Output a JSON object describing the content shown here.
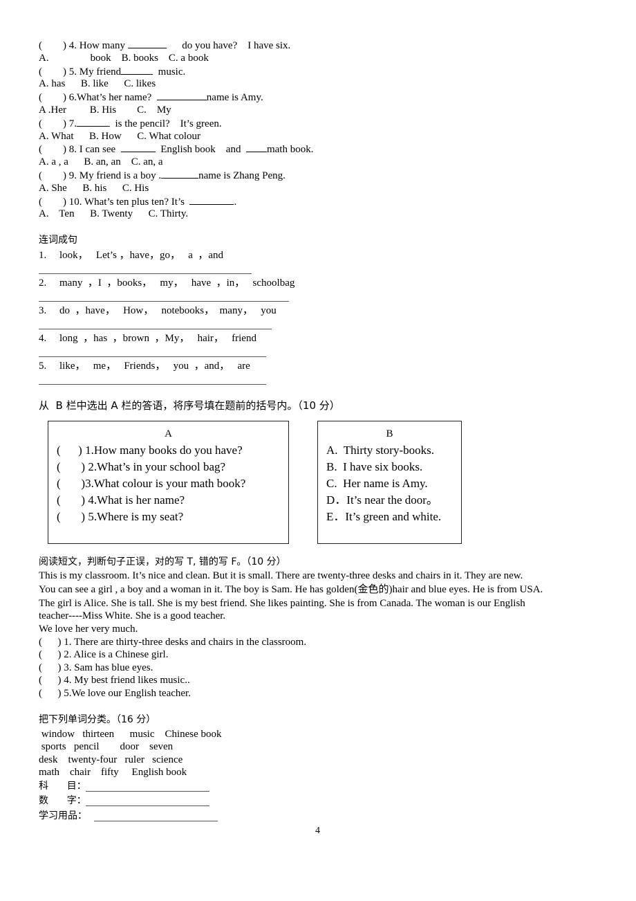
{
  "mcq": [
    {
      "paren": "(        ) ",
      "question": "4. How many ",
      "blank": true,
      "after": "      do you have?    I have six.",
      "options": "A.                book    B. books    C. a book"
    },
    {
      "paren": "(        ) ",
      "question": "5. My friend",
      "blank": true,
      "after": "  music.",
      "options": "A. has      B. like      C. likes"
    },
    {
      "paren": "(        ) ",
      "question": "6.What’s her name?  ",
      "blank": true,
      "after": "name is Amy.",
      "options": "A .Her         B. His        C.    My"
    },
    {
      "paren": "(        ) ",
      "question": "7.",
      "blank": true,
      "after": "  is the pencil?    It’s green.",
      "options": "A. What      B. How      C. What colour"
    },
    {
      "paren": "(        ) ",
      "question": "8. I can see  ",
      "blank": true,
      "after": "  English book    and  ",
      "blank2": true,
      "after2": "math book.",
      "options": "A. a , a      B. an, an    C. an, a"
    },
    {
      "paren": "(        ) ",
      "question": "9. My friend is a boy .",
      "blank": true,
      "after": "name is Zhang Peng.",
      "options": "A. She      B. his      C. His"
    },
    {
      "paren": "(        ) ",
      "question": "10. What’s ten plus ten? It’s  ",
      "blank": true,
      "after": ".",
      "options": "A.    Ten      B. Twenty      C. Thirty."
    }
  ],
  "sentence_section": {
    "title": "连词成句",
    "items": [
      "1.     look，   Let’s ，have，go，   a  ，and",
      "2.     many  ，I  ，books，   my，   have  ，in，   schoolbag",
      "3.     do  ，have，   How，   notebooks，  many，   you",
      "4.     long  ，has  ，brown  ，My，   hair，   friend",
      "5.     like，   me，   Friends，   you  ，and，   are"
    ]
  },
  "match_section": {
    "title": "从  B 栏中选出 A 栏的答语，将序号填在题前的括号内。（10 分）",
    "col_a_title": "A",
    "col_a": [
      "(      ) 1.How many books do you have?",
      "(       ) 2.What’s in your school bag?",
      "(       )3.What colour is your math book?",
      "(       ) 4.What is her name?",
      "(       ) 5.Where is my seat?"
    ],
    "col_b_title": "B",
    "col_b": [
      "A.  Thirty story-books.",
      "B.  I have six books.",
      "C.  Her name is Amy.",
      "D．It’s near the door。",
      "E．It’s green and white."
    ]
  },
  "reading_section": {
    "title": "阅读短文，判断句子正误，对的写 T, 错的写 F。（10 分）",
    "passage": [
      "This is my classroom. It’s nice and clean. But it is small. There are twenty-three desks and chairs in it. They are new.",
      "You can see a girl , a boy and a woman in it. The boy is Sam. He has golden(金色的)hair and blue eyes. He is from USA.",
      "The girl is Alice. She is tall. She is my best friend. She likes painting. She is from Canada. The woman is our English",
      "teacher----Miss White. She is a good teacher.",
      "We love her very much."
    ],
    "questions": [
      "(      ) 1. There are thirty-three desks and chairs in the classroom.",
      "(      ) 2. Alice is a Chinese girl.",
      "(      ) 3. Sam has blue eyes.",
      "(      ) 4. My best friend likes music..",
      "(      ) 5.We love our English teacher."
    ]
  },
  "classify_section": {
    "title": "把下列单词分类。（16 分）",
    "words": [
      " window   thirteen      music    Chinese book",
      " sports   pencil        door    seven",
      "desk    twenty-four   ruler   science",
      "math    chair    fifty     English book"
    ],
    "categories": [
      "科      目：",
      "数      字：",
      "学习用品："
    ]
  },
  "page_number": "4"
}
